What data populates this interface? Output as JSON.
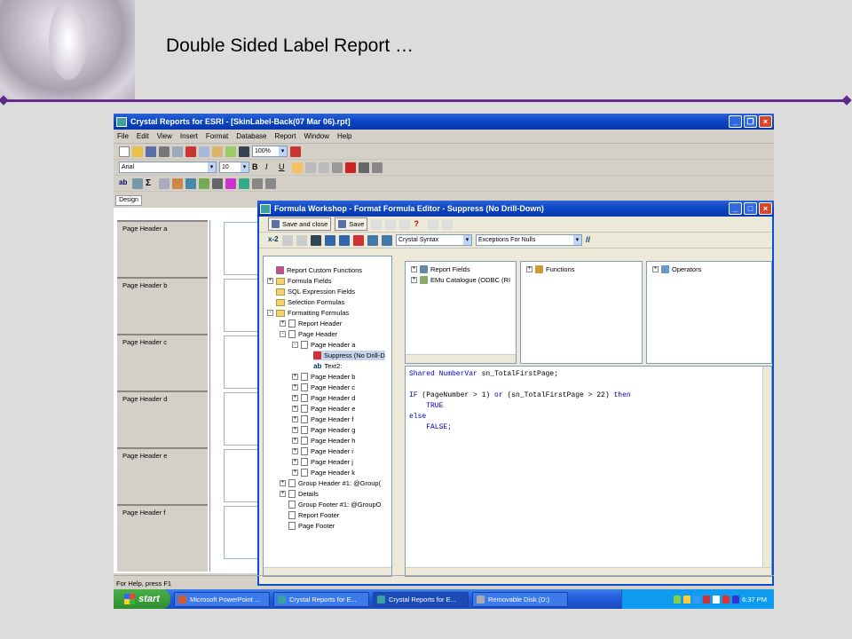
{
  "slide": {
    "title": "Double Sided Label Report …"
  },
  "app": {
    "title": "Crystal Reports for ESRI - [SkinLabel-Back(07 Mar 06).rpt]",
    "menu": [
      "File",
      "Edit",
      "View",
      "Insert",
      "Format",
      "Database",
      "Report",
      "Window",
      "Help"
    ],
    "zoom": "100%",
    "font": "Arial",
    "font_size": "10",
    "design_tab": "Design",
    "sections": [
      "Page Header a",
      "Page Header b",
      "Page Header c",
      "Page Header d",
      "Page Header e",
      "Page Header f"
    ],
    "status": "For Help, press F1"
  },
  "formula": {
    "title": "Formula Workshop - Format Formula Editor - Suppress (No Drill-Down)",
    "save_close": "Save and close",
    "save": "Save",
    "syntax": "Crystal Syntax",
    "nulls": "Exceptions For Nulls",
    "tree": [
      "Report Custom Functions",
      "Formula Fields",
      "SQL Expression Fields",
      "Selection Formulas",
      "Formatting Formulas",
      "Report Header",
      "Page Header",
      "Page Header a",
      "Suppress (No Drill-D",
      "Text2:",
      "Page Header b",
      "Page Header c",
      "Page Header d",
      "Page Header e",
      "Page Header f",
      "Page Header g",
      "Page Header h",
      "Page Header i",
      "Page Header j",
      "Page Header k",
      "Group Header #1: @Group(",
      "Details",
      "Group Footer #1: @GroupO",
      "Report Footer",
      "Page Footer"
    ],
    "fields": [
      "Report Fields",
      "EMu Catalogue (ODBC (RI"
    ],
    "functions": "Functions",
    "operators": "Operators",
    "code": [
      "Shared NumberVar sn_TotalFirstPage;",
      "",
      "IF (PageNumber > 1) or (sn_TotalFirstPage > 22) then",
      "    TRUE",
      "else",
      "    FALSE;"
    ]
  },
  "taskbar": {
    "start": "start",
    "items": [
      "Microsoft PowerPoint ...",
      "Crystal Reports for E...",
      "Crystal Reports for E...",
      "Removable Disk (D:)"
    ],
    "clock": "6:37 PM"
  }
}
